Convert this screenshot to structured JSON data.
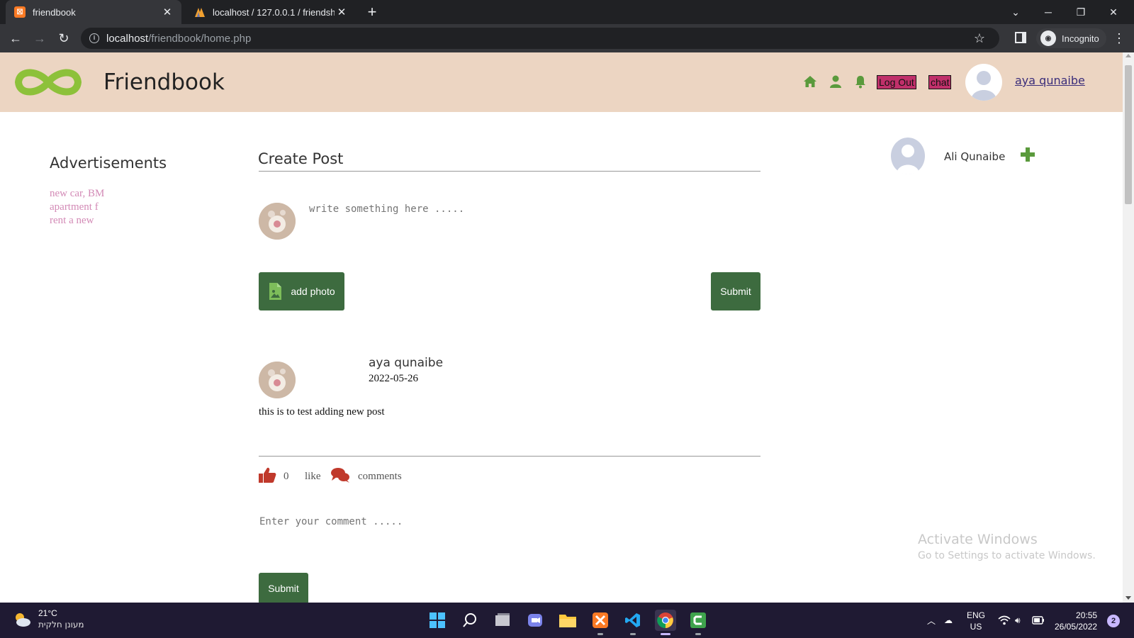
{
  "browser": {
    "tabs": [
      {
        "title": "friendbook",
        "active": true
      },
      {
        "title": "localhost / 127.0.0.1 / friendship",
        "active": false
      }
    ],
    "address": {
      "host": "localhost",
      "path": "/friendbook/home.php"
    },
    "profile_label": "Incognito"
  },
  "header": {
    "brand": "Friendbook",
    "logout_label": "Log Out",
    "chat_label": "chat",
    "username": "aya qunaibe",
    "accent_color": "#5a9a3c",
    "bg_color": "#ecd5c2"
  },
  "ads": {
    "title": "Advertisements",
    "items": [
      "new car, BM",
      "apartment f",
      "rent a new"
    ]
  },
  "create_post": {
    "title": "Create Post",
    "placeholder": "write something here .....",
    "add_photo_label": "add photo",
    "submit_label": "Submit"
  },
  "post": {
    "author": "aya qunaibe",
    "date": "2022-05-26",
    "body": "this is to test adding new post",
    "like_count": "0",
    "like_label": "like",
    "comments_label": "comments",
    "comment_placeholder": "Enter your comment .....",
    "comment_submit_label": "Submit"
  },
  "friends": [
    {
      "name": "Ali Qunaibe"
    }
  ],
  "watermark": {
    "title": "Activate Windows",
    "subtitle": "Go to Settings to activate Windows."
  },
  "taskbar": {
    "temperature": "21°C",
    "condition": "מעונן חלקית",
    "lang_top": "ENG",
    "lang_bottom": "US",
    "time": "20:55",
    "date": "26/05/2022",
    "notifications": "2"
  }
}
